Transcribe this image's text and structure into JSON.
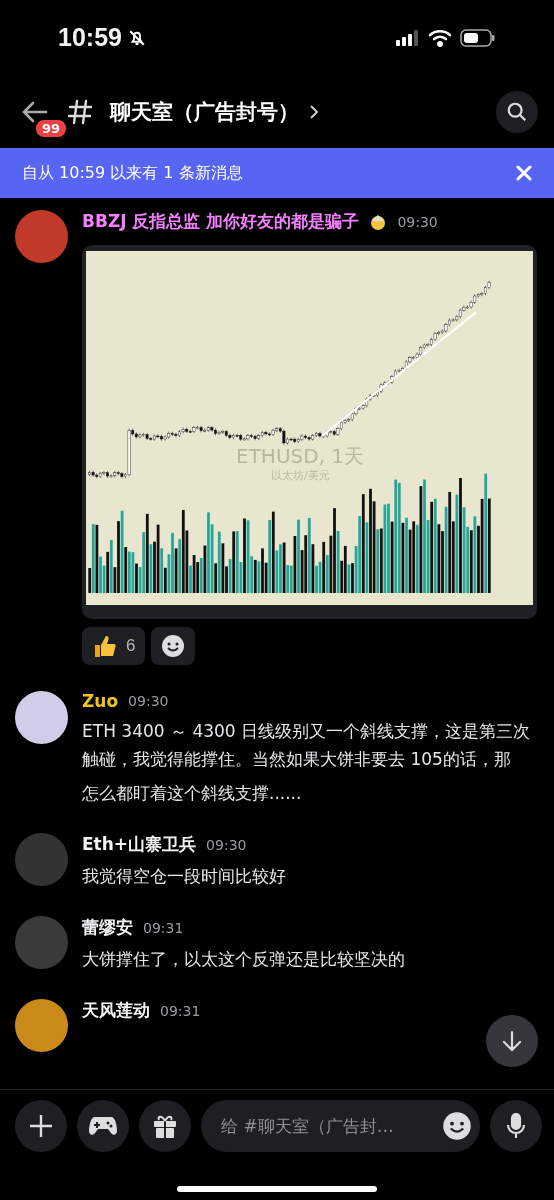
{
  "status_bar": {
    "time": "10:59"
  },
  "header": {
    "badge": "99",
    "title": "聊天室（广告封号）"
  },
  "banner": {
    "text": "自从 10:59 以来有 1 条新消息"
  },
  "messages": [
    {
      "author": "BBZJ 反指总监 加你好友的都是骗子",
      "color": "#f47fff",
      "time": "09:30",
      "kind": "image",
      "image": {
        "watermark": "ETHUSD, 1天",
        "subtitle": "以太坊/美元"
      },
      "reactions": [
        {
          "count": "6",
          "selected": false
        }
      ]
    },
    {
      "author": "Zuo",
      "color": "#f0c419",
      "time": "09:30",
      "kind": "text",
      "lines": [
        "ETH 3400 ～ 4300 日线级别又一个斜线支撑，这是第三次触碰，我觉得能撑住。当然如果大饼非要去 105的话，那",
        "怎么都盯着这个斜线支撑......"
      ]
    },
    {
      "author": "Eth+山寨卫兵",
      "color": "#f2f3f5",
      "time": "09:30",
      "kind": "text",
      "lines": [
        "我觉得空仓一段时间比较好"
      ]
    },
    {
      "author": "蕾缪安",
      "color": "#f2f3f5",
      "time": "09:31",
      "kind": "text",
      "lines": [
        "大饼撑住了，以太这个反弹还是比较坚决的"
      ]
    },
    {
      "author": "天风莲动",
      "color": "#f2f3f5",
      "time": "09:31",
      "kind": "text"
    }
  ],
  "composer": {
    "placeholder": "给 #聊天室（广告封…"
  }
}
